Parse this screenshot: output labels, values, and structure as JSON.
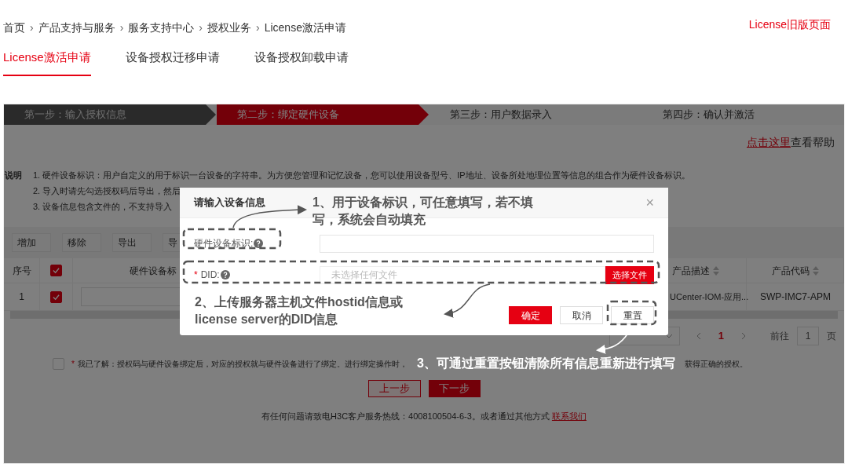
{
  "breadcrumb": [
    "首页",
    "产品支持与服务",
    "服务支持中心",
    "授权业务",
    "License激活申请"
  ],
  "breadcrumb_separator": "›",
  "old_version_link": "License旧版页面",
  "tabs": [
    {
      "label": "License激活申请",
      "selected": true
    },
    {
      "label": "设备授权迁移申请",
      "selected": false
    },
    {
      "label": "设备授权卸载申请",
      "selected": false
    }
  ],
  "steps": [
    {
      "label": "第一步：输入授权信息",
      "selected": false
    },
    {
      "label": "第二步：绑定硬件设备",
      "selected": true
    },
    {
      "label": "第三步：用户数据录入",
      "selected": false
    },
    {
      "label": "第四步：确认并激活",
      "selected": false
    }
  ],
  "help": {
    "link": "点击这里",
    "text": "查看帮助"
  },
  "notes": {
    "title": "说明",
    "lines": [
      "1. 硬件设备标识：用户自定义的用于标识一台设备的字符串。为方便您管理和记忆设备，您可以使用设备型号、IP地址、设备所处地理位置等信息的组合作为硬件设备标识。",
      "2. 导入时请先勾选授权码后导出，然后",
      "3. 设备信息包含文件的，不支持导入"
    ]
  },
  "toolbar": [
    "增加",
    "移除",
    "导出",
    "导"
  ],
  "table": {
    "columns": [
      "序号",
      "硬件设备标",
      "产品描述",
      "产品代码"
    ],
    "header_checked": true,
    "rows": [
      {
        "index": "1",
        "checked": true,
        "product": "UCenter-IOM-应用...",
        "code": "SWP-IMC7-APM"
      }
    ]
  },
  "pagination": {
    "pages": [
      {
        "label": "1",
        "selected": true
      }
    ],
    "goto_label": "前往",
    "goto_value": "1",
    "goto_suffix": "页"
  },
  "agreement": {
    "checked": false,
    "required": "*",
    "text_start": "我已了解：授权码与硬件设备绑定后，对应的授权就与硬件设备进行了绑定。进行绑定操作时，",
    "text_end": "获得正确的授权。"
  },
  "nav_buttons": {
    "prev": "上一步",
    "next": "下一步"
  },
  "footer": {
    "text": "有任何问题请致电H3C客户服务热线：4008100504-6-3。或者通过其他方式",
    "link": "联系我们"
  },
  "dialog": {
    "title": "请输入设备信息",
    "close": "×",
    "fields": [
      {
        "label": "硬件设备标识:",
        "required": false,
        "kind": "text"
      },
      {
        "label": "DID:",
        "required": true,
        "kind": "file",
        "placeholder": "未选择任何文件",
        "button": "选择文件"
      }
    ],
    "buttons": [
      {
        "label": "确定",
        "kind": "primary"
      },
      {
        "label": "取消",
        "kind": "plain"
      },
      {
        "label": "重置",
        "kind": "plain"
      }
    ]
  },
  "annotations": [
    {
      "lines": [
        "1、用于设备标识，可任意填写，若不填",
        "写，系统会自动填充"
      ],
      "color": "#555555"
    },
    {
      "lines": [
        "2、上传服务器主机文件hostid信息或",
        "license server的DID信息"
      ],
      "color": "#555555"
    },
    {
      "lines": [
        "3、可通过重置按钮清除所有信息重新进行填写"
      ],
      "color": "#ffffff"
    }
  ]
}
